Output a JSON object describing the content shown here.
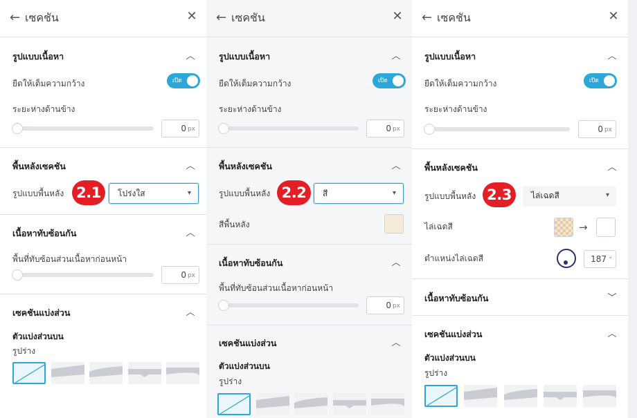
{
  "panels": [
    {
      "header": {
        "title": "เซคชัน",
        "back_icon": "arrow-left-icon",
        "close_icon": "close-icon"
      },
      "content_layout": {
        "label": "รูปแบบเนื้อหา",
        "stretch_label": "ยืดให้เต็มความกว้าง",
        "toggle_text": "เปิด",
        "side_spacing_label": "ระยะห่างด้านข้าง",
        "side_spacing_value": "0",
        "unit": "px"
      },
      "background": {
        "label": "พื้นหลังเซคชัน",
        "type_label": "รูปแบบพื้นหลัง",
        "type_value": "โปร่งใส",
        "step_badge": "2.1"
      },
      "overlap": {
        "label": "เนื้อหาทับซ้อนกัน",
        "area_label": "พื้นที่ทับซ้อนส่วนเนื้อหาก่อนหน้า",
        "area_value": "0",
        "unit": "px"
      },
      "divider": {
        "label": "เซคชันแบ่งส่วน",
        "top_label": "ตัวแบ่งส่วนบน",
        "shape_label": "รูปร่าง"
      }
    },
    {
      "header": {
        "title": "เซคชัน",
        "back_icon": "arrow-left-icon",
        "close_icon": "close-icon"
      },
      "content_layout": {
        "label": "รูปแบบเนื้อหา",
        "stretch_label": "ยืดให้เต็มความกว้าง",
        "toggle_text": "เปิด",
        "side_spacing_label": "ระยะห่างด้านข้าง",
        "side_spacing_value": "0",
        "unit": "px"
      },
      "background": {
        "label": "พื้นหลังเซคชัน",
        "type_label": "รูปแบบพื้นหลัง",
        "type_value": "สี",
        "step_badge": "2.2",
        "color_label": "สีพื้นหลัง",
        "color_value": "#f5ebd8"
      },
      "overlap": {
        "label": "เนื้อหาทับซ้อนกัน",
        "area_label": "พื้นที่ทับซ้อนส่วนเนื้อหาก่อนหน้า",
        "area_value": "0",
        "unit": "px"
      },
      "divider": {
        "label": "เซคชันแบ่งส่วน",
        "top_label": "ตัวแบ่งส่วนบน",
        "shape_label": "รูปร่าง"
      }
    },
    {
      "header": {
        "title": "เซคชัน",
        "back_icon": "arrow-left-icon",
        "close_icon": "close-icon"
      },
      "content_layout": {
        "label": "รูปแบบเนื้อหา",
        "stretch_label": "ยืดให้เต็มความกว้าง",
        "toggle_text": "เปิด",
        "side_spacing_label": "ระยะห่างด้านข้าง",
        "side_spacing_value": "0",
        "unit": "px"
      },
      "background": {
        "label": "พื้นหลังเซคชัน",
        "type_label": "รูปแบบพื้นหลัง",
        "type_value": "ไล่เฉดสี",
        "step_badge": "2.3",
        "gradient_label": "ไล่เฉดสี",
        "gradient_from": "#f4e6d0",
        "gradient_to": "#ffffff",
        "gradient_position_label": "ตำแหน่งไล่เฉดสี",
        "gradient_angle": "187",
        "angle_unit": "°"
      },
      "overlap": {
        "label": "เนื้อหาทับซ้อนกัน"
      },
      "divider": {
        "label": "เซคชันแบ่งส่วน",
        "top_label": "ตัวแบ่งส่วนบน",
        "shape_label": "รูปร่าง"
      }
    }
  ],
  "colors": {
    "accent": "#2ba7d9",
    "badge": "#e31e24",
    "dial": "#2f2f6e"
  },
  "divider_shapes": [
    "none",
    "tilt",
    "curve-asymmetric",
    "arrow",
    "curve"
  ]
}
